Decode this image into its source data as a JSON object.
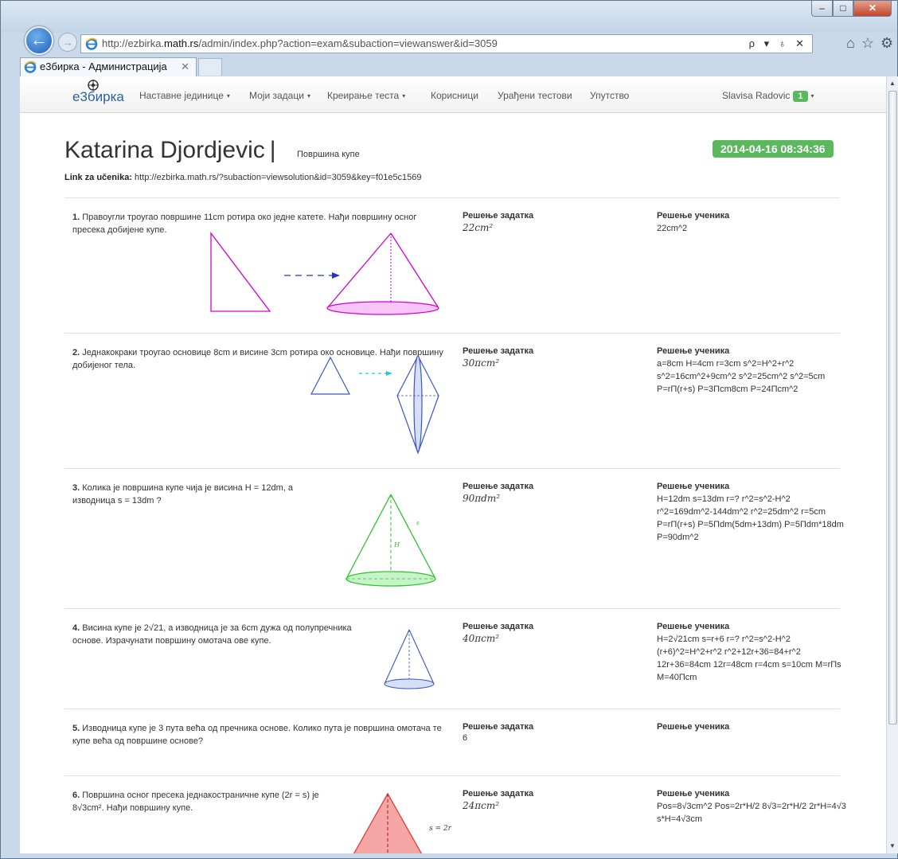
{
  "browser": {
    "url_prefix": "http://ezbirka.",
    "url_domain": "math.rs",
    "url_suffix": "/admin/index.php?action=exam&subaction=viewanswer&id=3059",
    "url_tools": "ρ ▾ ♁ ✕",
    "tab_title": "е3бирка - Администрација",
    "tab_close": "✕",
    "top_icons": "⌂☆⚙",
    "win_min": "–",
    "win_max": "□",
    "win_close": "✕",
    "back_glyph": "←",
    "fwd_glyph": "→"
  },
  "navbar": {
    "brand": "е3бирка",
    "items": [
      "Наставне јединице",
      "Моји задаци",
      "Креирање теста",
      "Корисници",
      "Урађени тестови",
      "Упутство"
    ],
    "user": "Slavisa Radovic",
    "badge": "1",
    "caret": "▾"
  },
  "header": {
    "student": "Katarina Djordjevic",
    "separator": "|",
    "test_name": "Површина купе",
    "date": "2014-04-16 08:34:36",
    "link_label": "Link za učenika:",
    "link_url": "http://ezbirka.math.rs/?subaction=viewsolution&id=3059&key=f01e5c1569"
  },
  "labels": {
    "solution": "Решење задатка",
    "student_solution": "Решење ученика"
  },
  "problems": [
    {
      "num": "1.",
      "text": "Правоугли троугао површине 11cm ротира око једне катете. Нађи површину осног пресека добијене купе.",
      "solution": "22cm²",
      "student": "22cm^2"
    },
    {
      "num": "2.",
      "text": "Једнакокраки троугао основице 8cm и висине 3cm ротира око основице. Нађи површину добијеног тела.",
      "solution": "30πcm²",
      "student": "a=8cm H=4cm r=3cm s^2=H^2+r^2 s^2=16cm^2+9cm^2 s^2=25cm^2 s^2=5cm P=rП(r+s) P=3Пcm8cm P=24Пcm^2"
    },
    {
      "num": "3.",
      "text": "Колика је површина купе чија је висина H = 12dm, а изводница s = 13dm ?",
      "solution": "90πdm²",
      "student": "H=12dm s=13dm r=? r^2=s^2-H^2 r^2=169dm^2-144dm^2 r^2=25dm^2 r=5cm P=rП(r+s) P=5Пdm(5dm+13dm) P=5Пdm*18dm P=90dm^2",
      "fig_h": "H",
      "fig_s": "s"
    },
    {
      "num": "4.",
      "text": "Висина купе је 2√21, а изводница је за 6cm дужа од полупречника основе. Израчунати површину омотача ове купе.",
      "solution": "40πcm²",
      "student": "H=2√21cm s=r+6 r=? r^2=s^2-H^2 (r+6)^2=H^2+r^2 r^2+12r+36=84+r^2 12r+36=84cm 12r=48cm r=4cm s=10cm M=rПs M=40Пcm"
    },
    {
      "num": "5.",
      "text": "Изводница купе је 3 пута већа од пречника основе. Колико пута је површина омотача те купе већа од површине основе?",
      "solution": "6",
      "student": ""
    },
    {
      "num": "6.",
      "text": "Површина осног пресека једнакостраничне купе (2r = s) је 8√3cm². Нађи површину купе.",
      "solution": "24πcm²",
      "student": "Pos=8√3cm^2 Pos=2r*H/2 8√3=2r*H/2 2r*H=4√3 s*H=4√3cm",
      "fig_label": "s = 2r"
    }
  ]
}
